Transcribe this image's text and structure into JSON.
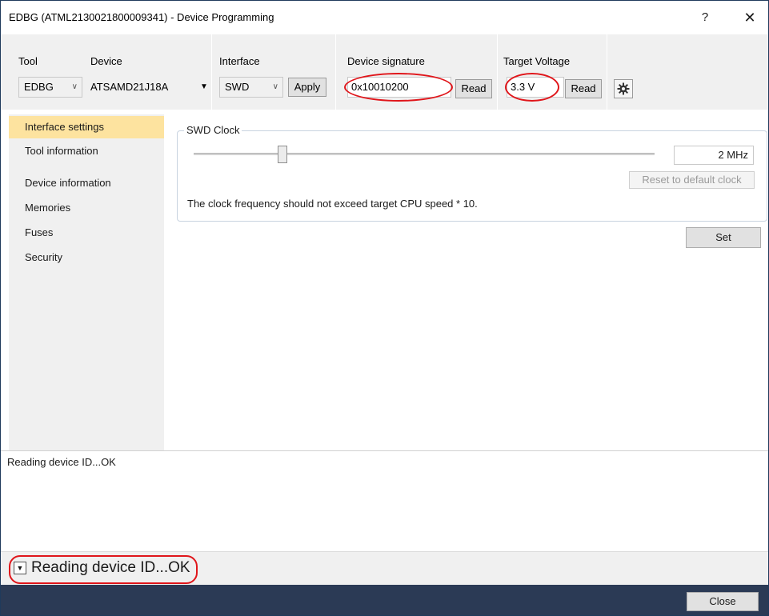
{
  "window": {
    "title": "EDBG (ATML2130021800009341) - Device Programming",
    "help_label": "?",
    "close_glyph": "✕"
  },
  "toolbar": {
    "tool_label": "Tool",
    "tool_value": "EDBG",
    "device_label": "Device",
    "device_value": "ATSAMD21J18A",
    "interface_label": "Interface",
    "interface_value": "SWD",
    "apply_label": "Apply",
    "signature_label": "Device signature",
    "signature_value": "0x10010200",
    "signature_read_label": "Read",
    "voltage_label": "Target Voltage",
    "voltage_value": "3.3 V",
    "voltage_read_label": "Read",
    "settings_icon": "gear-icon"
  },
  "sidebar": {
    "items": [
      {
        "label": "Interface settings",
        "active": true
      },
      {
        "label": "Tool information"
      },
      {
        "label": "Device information"
      },
      {
        "label": "Memories"
      },
      {
        "label": "Fuses"
      },
      {
        "label": "Security"
      }
    ]
  },
  "swd": {
    "legend": "SWD Clock",
    "clock_value": "2 MHz",
    "reset_label": "Reset to default clock",
    "note": "The clock frequency should not exceed target CPU speed * 10.",
    "set_label": "Set"
  },
  "log": {
    "line": "Reading device ID...OK"
  },
  "status": {
    "text": "Reading device ID...OK"
  },
  "footer": {
    "close_label": "Close"
  },
  "colors": {
    "highlight_ellipse": "#e0161b",
    "active_nav": "#fde39f",
    "bottom_bar": "#2b3a55"
  }
}
